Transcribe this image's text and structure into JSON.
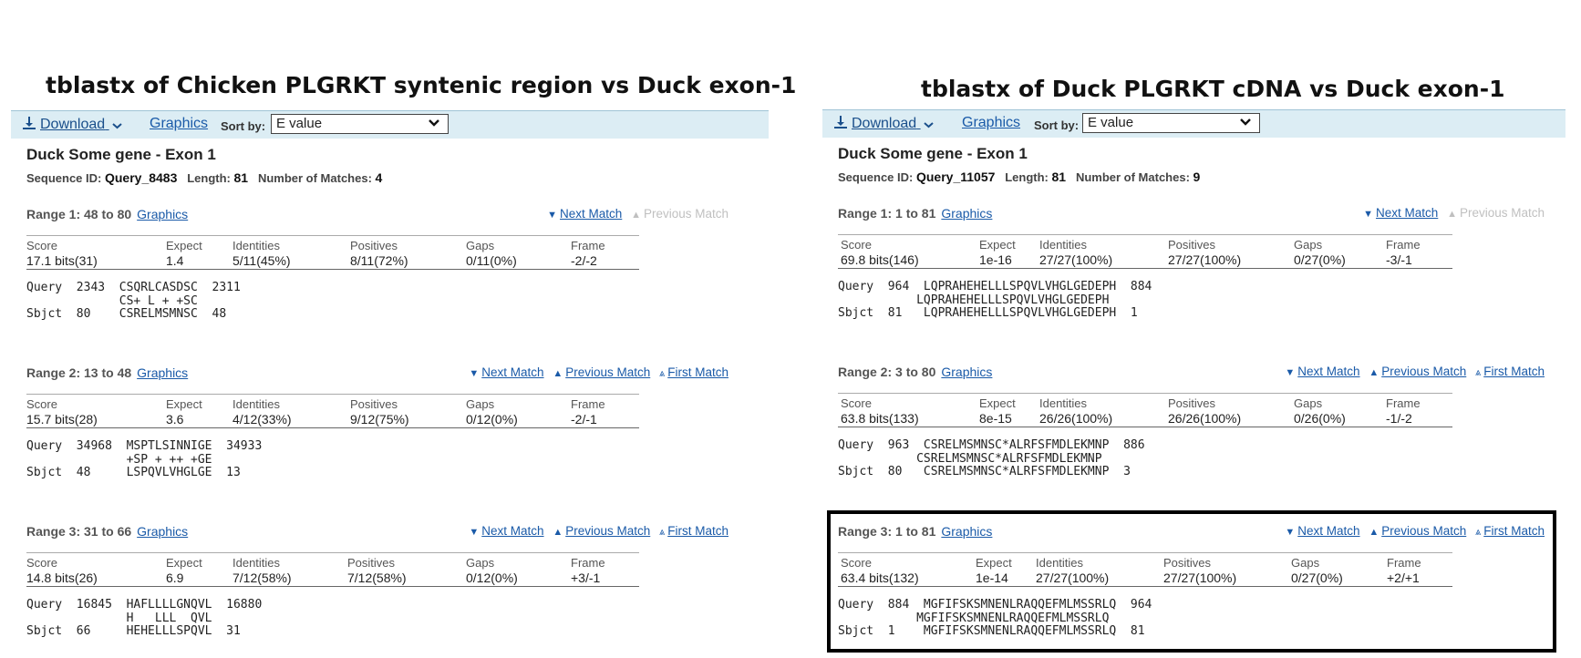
{
  "panels": [
    {
      "title": "tblastx of Chicken PLGRKT syntenic region vs Duck exon-1",
      "toolbar": {
        "download": "Download",
        "graphics": "Graphics",
        "sort_label": "Sort by:",
        "sort_value": "E value"
      },
      "seq_title": "Duck Some gene - Exon 1",
      "seq_meta": {
        "id_label": "Sequence ID:",
        "id": "Query_8483",
        "length_label": "Length:",
        "length": "81",
        "matches_label": "Number of Matches:",
        "matches": "4"
      },
      "ranges": [
        {
          "label": "Range 1: 48 to 80",
          "graphics": "Graphics",
          "nav": {
            "next": "Next Match",
            "prev": "Previous Match",
            "first": ""
          },
          "prev_disabled": true,
          "stats": {
            "score_h": "Score",
            "score": "17.1 bits(31)",
            "expect_h": "Expect",
            "expect": "1.4",
            "ident_h": "Identities",
            "ident": "5/11(45%)",
            "pos_h": "Positives",
            "pos": "8/11(72%)",
            "gaps_h": "Gaps",
            "gaps": "0/11(0%)",
            "frame_h": "Frame",
            "frame": "-2/-2"
          },
          "alignment": "Query  2343  CSQRLCASDSC  2311\n             CS+ L + +SC\nSbjct  80    CSRELMSMNSC  48"
        },
        {
          "label": "Range 2: 13 to 48",
          "graphics": "Graphics",
          "nav": {
            "next": "Next Match",
            "prev": "Previous Match",
            "first": "First Match"
          },
          "prev_disabled": false,
          "stats": {
            "score_h": "Score",
            "score": "15.7 bits(28)",
            "expect_h": "Expect",
            "expect": "3.6",
            "ident_h": "Identities",
            "ident": "4/12(33%)",
            "pos_h": "Positives",
            "pos": "9/12(75%)",
            "gaps_h": "Gaps",
            "gaps": "0/12(0%)",
            "frame_h": "Frame",
            "frame": "-2/-1"
          },
          "alignment": "Query  34968  MSPTLSINNIGE  34933\n              +SP + ++ +GE\nSbjct  48     LSPQVLVHGLGE  13"
        },
        {
          "label": "Range 3: 31 to 66",
          "graphics": "Graphics",
          "nav": {
            "next": "Next Match",
            "prev": "Previous Match",
            "first": "First Match"
          },
          "prev_disabled": false,
          "stats": {
            "score_h": "Score",
            "score": "14.8 bits(26)",
            "expect_h": "Expect",
            "expect": "6.9",
            "ident_h": "Identities",
            "ident": "7/12(58%)",
            "pos_h": "Positives",
            "pos": "7/12(58%)",
            "gaps_h": "Gaps",
            "gaps": "0/12(0%)",
            "frame_h": "Frame",
            "frame": "+3/-1"
          },
          "alignment": "Query  16845  HAFLLLLGNQVL  16880\n              H   LLL  QVL\nSbjct  66     HEHELLLSPQVL  31"
        }
      ]
    },
    {
      "title": "tblastx of Duck PLGRKT cDNA vs Duck exon-1",
      "toolbar": {
        "download": "Download",
        "graphics": "Graphics",
        "sort_label": "Sort by:",
        "sort_value": "E value"
      },
      "seq_title": "Duck Some gene - Exon 1",
      "seq_meta": {
        "id_label": "Sequence ID:",
        "id": "Query_11057",
        "length_label": "Length:",
        "length": "81",
        "matches_label": "Number of Matches:",
        "matches": "9"
      },
      "ranges": [
        {
          "label": "Range 1: 1 to 81",
          "graphics": "Graphics",
          "nav": {
            "next": "Next Match",
            "prev": "Previous Match",
            "first": ""
          },
          "prev_disabled": true,
          "stats": {
            "score_h": "Score",
            "score": "69.8 bits(146)",
            "expect_h": "Expect",
            "expect": "1e-16",
            "ident_h": "Identities",
            "ident": "27/27(100%)",
            "pos_h": "Positives",
            "pos": "27/27(100%)",
            "gaps_h": "Gaps",
            "gaps": "0/27(0%)",
            "frame_h": "Frame",
            "frame": "-3/-1"
          },
          "alignment": "Query  964  LQPRAHEHELLLSPQVLVHGLGEDEPH  884\n           LQPRAHEHELLLSPQVLVHGLGEDEPH\nSbjct  81   LQPRAHEHELLLSPQVLVHGLGEDEPH  1"
        },
        {
          "label": "Range 2: 3 to 80",
          "graphics": "Graphics",
          "nav": {
            "next": "Next Match",
            "prev": "Previous Match",
            "first": "First Match"
          },
          "prev_disabled": false,
          "stats": {
            "score_h": "Score",
            "score": "63.8 bits(133)",
            "expect_h": "Expect",
            "expect": "8e-15",
            "ident_h": "Identities",
            "ident": "26/26(100%)",
            "pos_h": "Positives",
            "pos": "26/26(100%)",
            "gaps_h": "Gaps",
            "gaps": "0/26(0%)",
            "frame_h": "Frame",
            "frame": "-1/-2"
          },
          "alignment": "Query  963  CSRELMSMNSC*ALRFSFMDLEKMNP  886\n           CSRELMSMNSC*ALRFSFMDLEKMNP\nSbjct  80   CSRELMSMNSC*ALRFSFMDLEKMNP  3"
        },
        {
          "label": "Range 3: 1 to 81",
          "graphics": "Graphics",
          "nav": {
            "next": "Next Match",
            "prev": "Previous Match",
            "first": "First Match"
          },
          "prev_disabled": false,
          "stats": {
            "score_h": "Score",
            "score": "63.4 bits(132)",
            "expect_h": "Expect",
            "expect": "1e-14",
            "ident_h": "Identities",
            "ident": "27/27(100%)",
            "pos_h": "Positives",
            "pos": "27/27(100%)",
            "gaps_h": "Gaps",
            "gaps": "0/27(0%)",
            "frame_h": "Frame",
            "frame": "+2/+1"
          },
          "alignment": "Query  884  MGFIFSKSMNENLRAQQEFMLMSSRLQ  964\n           MGFIFSKSMNENLRAQQEFMLMSSRLQ\nSbjct  1    MGFIFSKSMNENLRAQQEFMLMSSRLQ  81"
        }
      ]
    }
  ]
}
